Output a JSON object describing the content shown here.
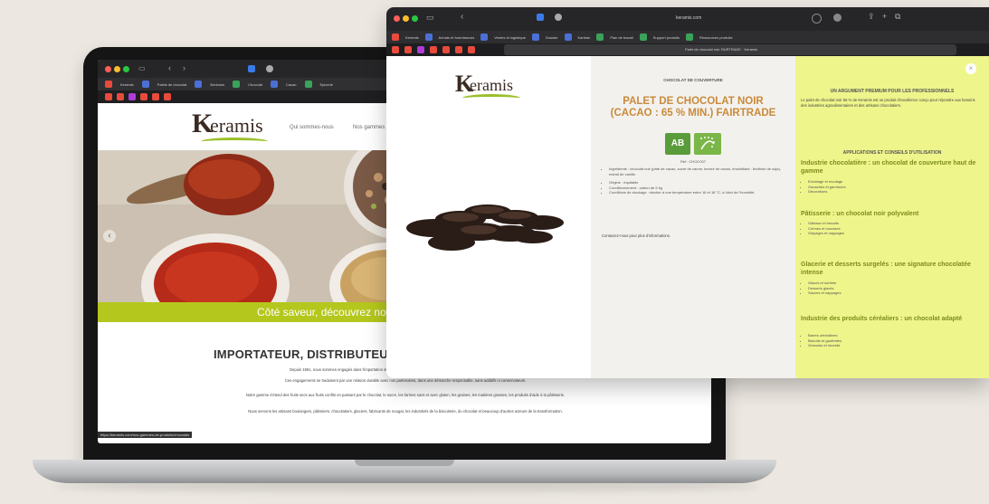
{
  "laptop": {
    "browser": {
      "bookmarks": [
        "Keramis",
        "Palets de chocolat",
        "Bonbons",
        "Chocolat",
        "Cacao",
        "Epicerie",
        "Fournisseurs"
      ],
      "url": "keramis.com"
    },
    "header": {
      "logo_text": "eramis",
      "logo_letter": "K",
      "nav": [
        "Qui sommes-nous",
        "Nos gammes de produits"
      ]
    },
    "hero": {
      "band_text": "Côté saveur, découvrez notre gamme",
      "prev_arrow": "‹"
    },
    "main": {
      "title": "IMPORTATEUR, DISTRIBUTEUR ET FABRICANT",
      "paragraphs": [
        "Depuis 1991, nous sommes engagés dans l'importation de matières premières bio, la fabrication et la distribution de produits alimentaires.",
        "Ces engagements se traduisent par une relation durable avec nos partenaires, dans une démarche responsable, sans additifs ni conservateurs.",
        "Notre gamme s'étend des fruits secs aux fruits confits en passant par le chocolat, le sucre, les farines sans et avec gluten, les graines, les matières grasses, les produits d'aide à la pâtisserie.",
        "Nous servons les artisans boulangers, pâtissiers, chocolatiers, glaciers, fabricants de nougat, les industriels de la biscuiterie, du chocolat et beaucoup d'autres acteurs de la transformation."
      ],
      "status_bar": "https://keramis.com/nos-gammes-de-produits/chocolats"
    }
  },
  "window": {
    "browser": {
      "url": "keramis.com",
      "bookmarks": [
        "Keramis",
        "Achats et fournisseurs",
        "Ventes et logistique",
        "Dossier",
        "Kanban",
        "Plan de travail",
        "Support produits",
        "Ressources produits",
        "Contact client",
        "Nouveautés"
      ],
      "tab_title": "Palet de chocolat noir FAIRTRADE · Keramis"
    },
    "logo_text": "eramis",
    "logo_letter": "K",
    "product": {
      "category": "CHOCOLAT DE COUVERTURE",
      "title": "PALET DE CHOCOLAT NOIR (CACAO : 65 % MIN.) FAIRTRADE",
      "badge_text": "AB",
      "ref": "Réf : CHOC007",
      "bullets": [
        "Ingrédients : chocolat noir (pâte de cacao, sucre de canne, beurre de cacao, émulsifiant : lécithine de soja), extrait de vanille.",
        "Origine : équitable",
        "Conditionnement : carton de 5 kg",
        "Conditions de stockage : stocker à une température entre 16 et 18 °C, à l'abri de l'humidité."
      ],
      "note": "Contactez-nous pour plus d'informations."
    },
    "right_panel": {
      "intro_heading": "UN ARGUMENT PREMIUM POUR LES PROFESSIONNELS",
      "intro_text": "Le palet de chocolat noir 65 % de Keramis est un produit d'excellence conçu pour répondre aux besoins des industries agroalimentaires et des artisans chocolatiers.",
      "app_heading": "APPLICATIONS ET CONSEILS D'UTILISATION",
      "sections": [
        {
          "title": "Industrie chocolatière : un chocolat de couverture haut de gamme",
          "bullets": [
            "Enrobage et moulage",
            "Ganaches et garnitures",
            "Décorations"
          ]
        },
        {
          "title": "Pâtisserie : un chocolat noir polyvalent",
          "bullets": [
            "Gâteaux et biscuits",
            "Crèmes et mousses",
            "Glaçages et nappages"
          ]
        },
        {
          "title": "Glacerie et desserts surgelés : une signature chocolatée intense",
          "bullets": [
            "Glaces et sorbets",
            "Desserts glacés",
            "Sauces et nappages"
          ]
        },
        {
          "title": "Industrie des produits céréaliers : un chocolat adapté",
          "bullets": [
            "Barres céréalières",
            "Biscuits et gaufrettes",
            "Granolas et mueslis"
          ]
        }
      ]
    }
  }
}
